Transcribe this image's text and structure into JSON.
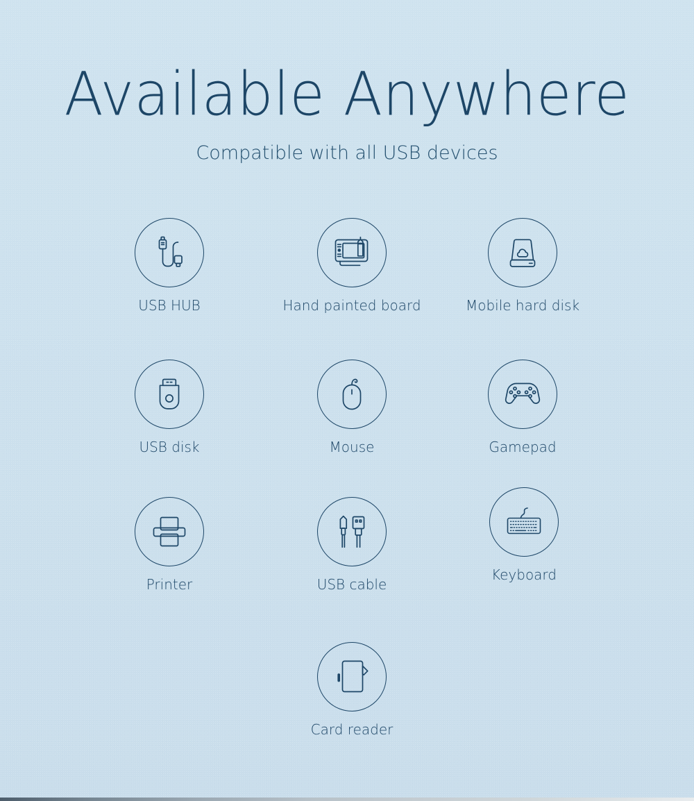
{
  "theme": {
    "background": "#cde1ee",
    "ink": "#1d4667",
    "subhead_ink": "#24506f",
    "stroke": "#1d4667"
  },
  "header": {
    "title": "Available Anywhere",
    "subtitle": "Compatible with all USB devices"
  },
  "grid": {
    "items": [
      {
        "label": "USB HUB",
        "icon": "usb-hub-icon"
      },
      {
        "label": "Hand painted board",
        "icon": "drawing-tablet-icon"
      },
      {
        "label": "Mobile hard disk",
        "icon": "hard-disk-icon"
      },
      {
        "label": "USB disk",
        "icon": "usb-flash-drive-icon"
      },
      {
        "label": "Mouse",
        "icon": "mouse-icon"
      },
      {
        "label": "Gamepad",
        "icon": "gamepad-icon"
      },
      {
        "label": "Printer",
        "icon": "printer-icon"
      },
      {
        "label": "USB cable",
        "icon": "usb-cable-icon"
      },
      {
        "label": "Keyboard",
        "icon": "keyboard-icon"
      },
      {
        "label": "Card reader",
        "icon": "card-reader-icon"
      }
    ]
  }
}
